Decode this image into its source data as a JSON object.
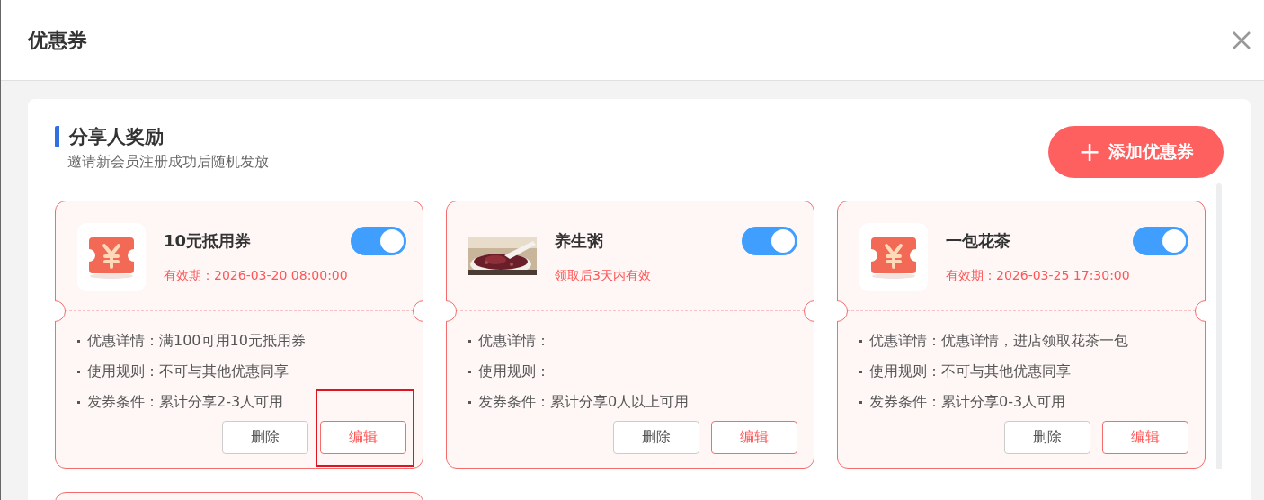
{
  "dialog": {
    "title": "优惠券"
  },
  "section": {
    "title": "分享人奖励",
    "subtitle": "邀请新会员注册成功后随机发放",
    "add_button": {
      "icon": "+",
      "label": "添加优惠券"
    }
  },
  "coupons": [
    {
      "kind": "ticket",
      "name": "10元抵用券",
      "validity": "有效期：2026-03-20 08:00:00",
      "on": true,
      "details": [
        {
          "label": "优惠详情：",
          "value": "满100可用10元抵用券"
        },
        {
          "label": "使用规则：",
          "value": "不可与其他优惠同享"
        },
        {
          "label": "发券条件：",
          "value": "累计分享2-3人可用"
        }
      ],
      "delete_label": "删除",
      "edit_label": "编辑",
      "edit_highlighted": true
    },
    {
      "kind": "picture",
      "name": "养生粥",
      "validity": "领取后3天内有效",
      "on": true,
      "details": [
        {
          "label": "优惠详情："
        },
        {
          "label": "使用规则："
        },
        {
          "label": "发券条件：",
          "value": "累计分享0人以上可用"
        }
      ],
      "delete_label": "删除",
      "edit_label": "编辑",
      "edit_highlighted": false
    },
    {
      "kind": "ticket",
      "name": "一包花茶",
      "validity": "有效期：2026-03-25 17:30:00",
      "on": true,
      "details": [
        {
          "label": "优惠详情：",
          "value": "优惠详情，进店领取花茶一包"
        },
        {
          "label": "使用规则：",
          "value": "不可与其他优惠同享"
        },
        {
          "label": "发券条件：",
          "value": "累计分享0-3人可用"
        }
      ],
      "delete_label": "删除",
      "edit_label": "编辑",
      "edit_highlighted": false
    }
  ]
}
